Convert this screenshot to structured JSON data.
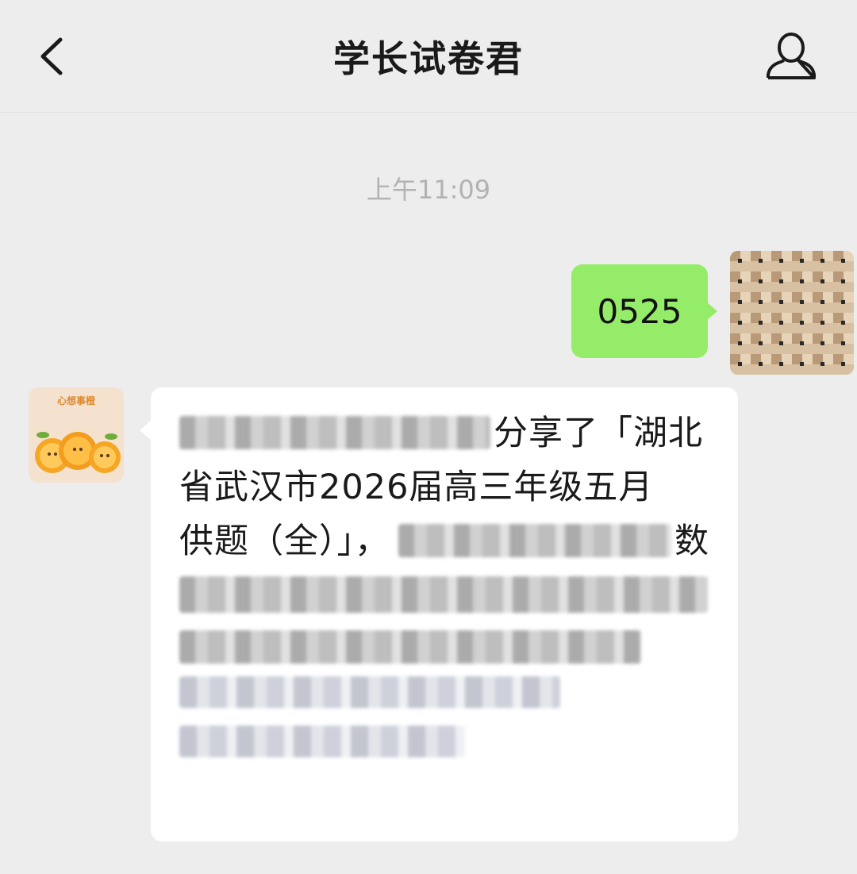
{
  "header": {
    "title": "学长试卷君",
    "back_icon": "chevron-left-icon",
    "profile_icon": "person-icon"
  },
  "chat": {
    "timestamp": "上午11:09",
    "outgoing": {
      "text": "0525",
      "bubble_color": "#95ec69"
    },
    "incoming": {
      "avatar_text": "心想事橙",
      "line1_visible": "分享了「湖北",
      "line2": "省武汉市2026届高三年级五月",
      "line3_visible": "供题（全）」，",
      "line3_end": "数",
      "bubble_color": "#ffffff"
    }
  }
}
